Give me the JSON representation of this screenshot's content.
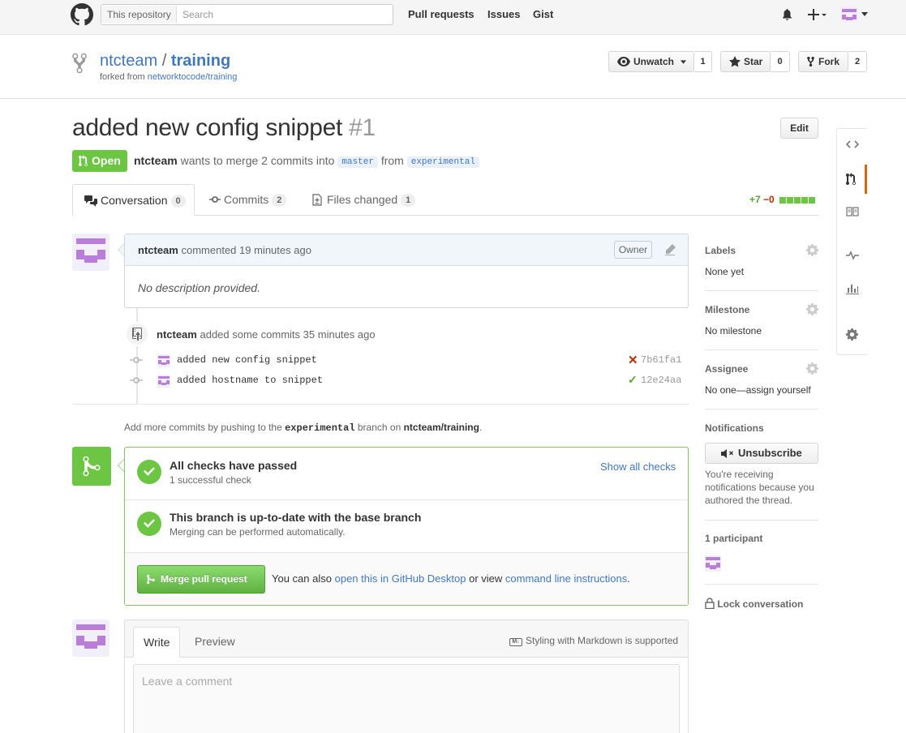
{
  "header": {
    "search_scope": "This repository",
    "search_placeholder": "Search",
    "nav": [
      "Pull requests",
      "Issues",
      "Gist"
    ],
    "icons": [
      "github-logo-icon",
      "bell-icon",
      "plus-icon",
      "avatar-dropdown"
    ]
  },
  "repo": {
    "owner": "ntcteam",
    "name": "training",
    "forked_prefix": "forked from",
    "forked_from": "networktocode/training",
    "watch_label": "Unwatch",
    "watch_count": "1",
    "star_label": "Star",
    "star_count": "0",
    "fork_label": "Fork",
    "fork_count": "2"
  },
  "pr": {
    "title": "added new config snippet",
    "number": "#1",
    "edit_label": "Edit",
    "state": "Open",
    "author": "ntcteam",
    "meta_text": "wants to merge 2 commits into",
    "base_branch": "master",
    "from_text": "from",
    "head_branch": "experimental"
  },
  "tabs": [
    {
      "label": "Conversation",
      "count": "0"
    },
    {
      "label": "Commits",
      "count": "2"
    },
    {
      "label": "Files changed",
      "count": "1"
    }
  ],
  "diffstat": {
    "additions": "+7",
    "deletions": "−0"
  },
  "comment": {
    "author": "ntcteam",
    "action": "commented",
    "time": "19 minutes ago",
    "badge": "Owner",
    "body": "No description provided."
  },
  "push_event": {
    "author": "ntcteam",
    "text": "added some commits",
    "time": "35 minutes ago",
    "commits": [
      {
        "message": "added new config snippet",
        "sha": "7b61fa1",
        "status": "failure"
      },
      {
        "message": "added hostname to snippet",
        "sha": "12e24aa",
        "status": "success"
      }
    ]
  },
  "push_help": {
    "prefix": "Add more commits by pushing to the",
    "branch": "experimental",
    "middle": "branch on",
    "repo": "ntcteam/training",
    "suffix": "."
  },
  "merge": {
    "checks_title": "All checks have passed",
    "checks_sub": "1 successful check",
    "show_all": "Show all checks",
    "branch_title": "This branch is up-to-date with the base branch",
    "branch_sub": "Merging can be performed automatically.",
    "button": "Merge pull request",
    "also": "You can also",
    "desktop_link": "open this in GitHub Desktop",
    "or_view": "or view",
    "cli_link": "command line instructions",
    "end": "."
  },
  "new_comment": {
    "write_tab": "Write",
    "preview_tab": "Preview",
    "markdown_hint": "Styling with Markdown is supported",
    "placeholder": "Leave a comment"
  },
  "sidebar": {
    "labels_title": "Labels",
    "labels_value": "None yet",
    "milestone_title": "Milestone",
    "milestone_value": "No milestone",
    "assignee_title": "Assignee",
    "assignee_value": "No one—assign yourself",
    "notifications_title": "Notifications",
    "unsubscribe": "Unsubscribe",
    "notifications_note": "You're receiving notifications because you authored the thread.",
    "participants": "1 participant",
    "lock": "Lock conversation"
  },
  "colors": {
    "accent": "#4078c0",
    "open_green": "#6cc644",
    "rail_selected": "#d26911"
  }
}
